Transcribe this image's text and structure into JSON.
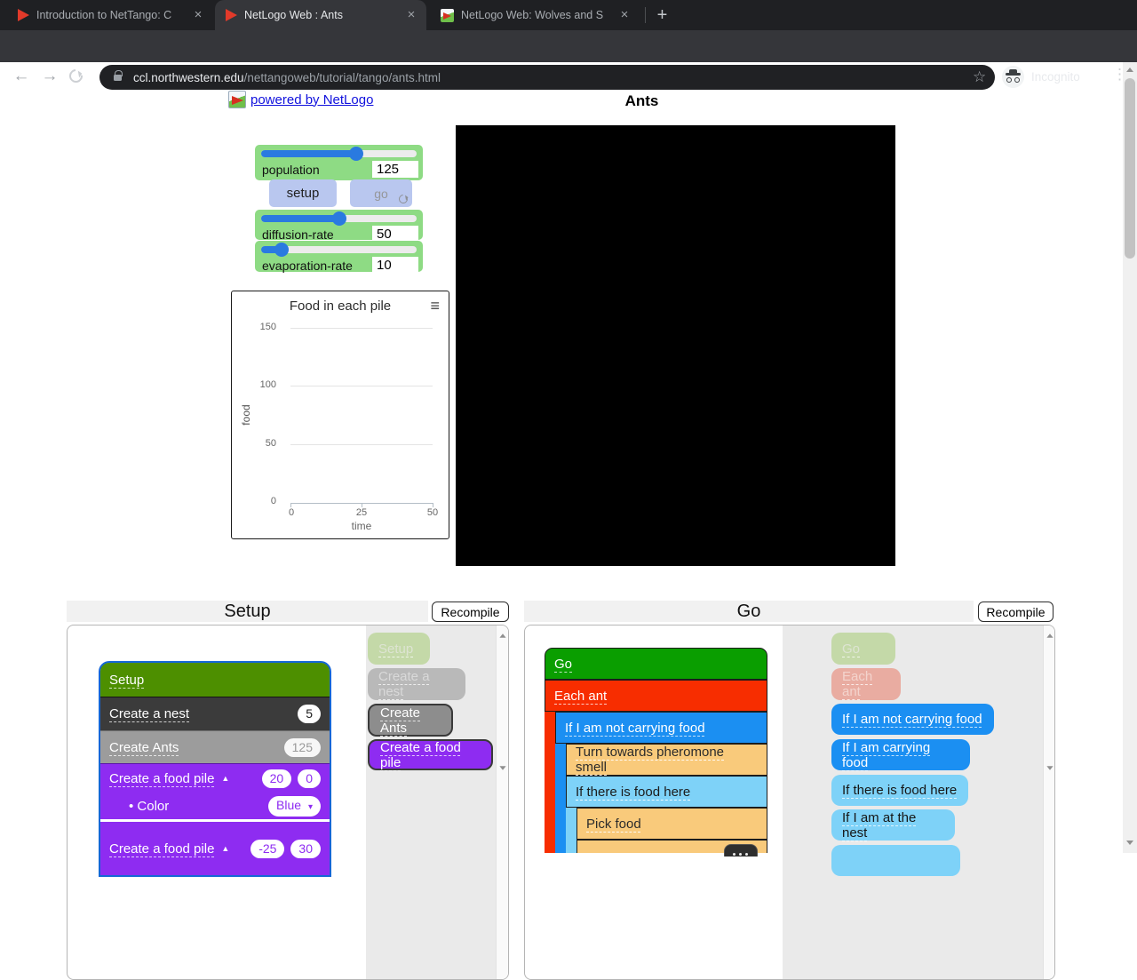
{
  "browser": {
    "tabs": [
      {
        "title": "Introduction to NetTango: C"
      },
      {
        "title": "NetLogo Web : Ants"
      },
      {
        "title": "NetLogo Web: Wolves and S"
      }
    ],
    "url_host": "ccl.northwestern.edu",
    "url_path": "/nettangoweb/tutorial/tango/ants.html",
    "incognito_label": "Incognito"
  },
  "page": {
    "powered_by_label": "powered by NetLogo",
    "model_title": "Ants"
  },
  "widgets": {
    "setup_label": "setup",
    "go_label": "go",
    "sliders": [
      {
        "label": "population",
        "value": "125"
      },
      {
        "label": "diffusion-rate",
        "value": "50"
      },
      {
        "label": "evaporation-rate",
        "value": "10"
      }
    ]
  },
  "chart_data": {
    "type": "line",
    "title": "Food in each pile",
    "xlabel": "time",
    "ylabel": "food",
    "xlim": [
      0,
      50
    ],
    "ylim": [
      0,
      150
    ],
    "xticks": [
      "0",
      "25",
      "50"
    ],
    "yticks": [
      "0",
      "50",
      "100",
      "150"
    ],
    "grid": true,
    "legend": false,
    "series": []
  },
  "setup_panel": {
    "title": "Setup",
    "recompile_label": "Recompile",
    "chain": {
      "setup_label": "Setup",
      "create_nest_label": "Create a nest",
      "create_nest_badge": "5",
      "create_ants_label": "Create Ants",
      "create_ants_badge": "125",
      "pile1_label": "Create a food pile",
      "pile1_badge_x": "20",
      "pile1_badge_y": "0",
      "pile1_color_label": "• Color",
      "pile1_color_value": "Blue",
      "pile2_label": "Create a food pile",
      "pile2_badge_x": "-25",
      "pile2_badge_y": "30"
    },
    "palette": [
      "Setup",
      "Create a nest",
      "Create Ants",
      "Create a food pile"
    ]
  },
  "go_panel": {
    "title": "Go",
    "recompile_label": "Recompile",
    "chain": {
      "go_label": "Go",
      "each_ant_label": "Each ant",
      "if_not_carrying_label": "If I am not carrying food",
      "turn_towards_label": "Turn towards pheromone smell",
      "if_food_here_label": "If there is food here",
      "pick_food_label": "Pick food"
    },
    "palette": [
      "Go",
      "Each ant",
      "If I am not carrying food",
      "If I am carrying food",
      "If there is food here",
      "If I am at the nest"
    ]
  },
  "colors": {
    "slider_bg": "#8edb84",
    "widget_button_bg": "#b9c7ef",
    "block_setup_green": "#4d8f00",
    "block_go_green": "#0a9e00",
    "block_red": "#f72d00",
    "block_blue": "#1b8ff2",
    "block_light_blue": "#7ed2f8",
    "block_tan": "#f9ca7b",
    "block_purple": "#8e2cf1",
    "block_dark_gray": "#3b3b3b",
    "block_gray": "#9c9c9c",
    "selection_outline": "#1566d6"
  }
}
